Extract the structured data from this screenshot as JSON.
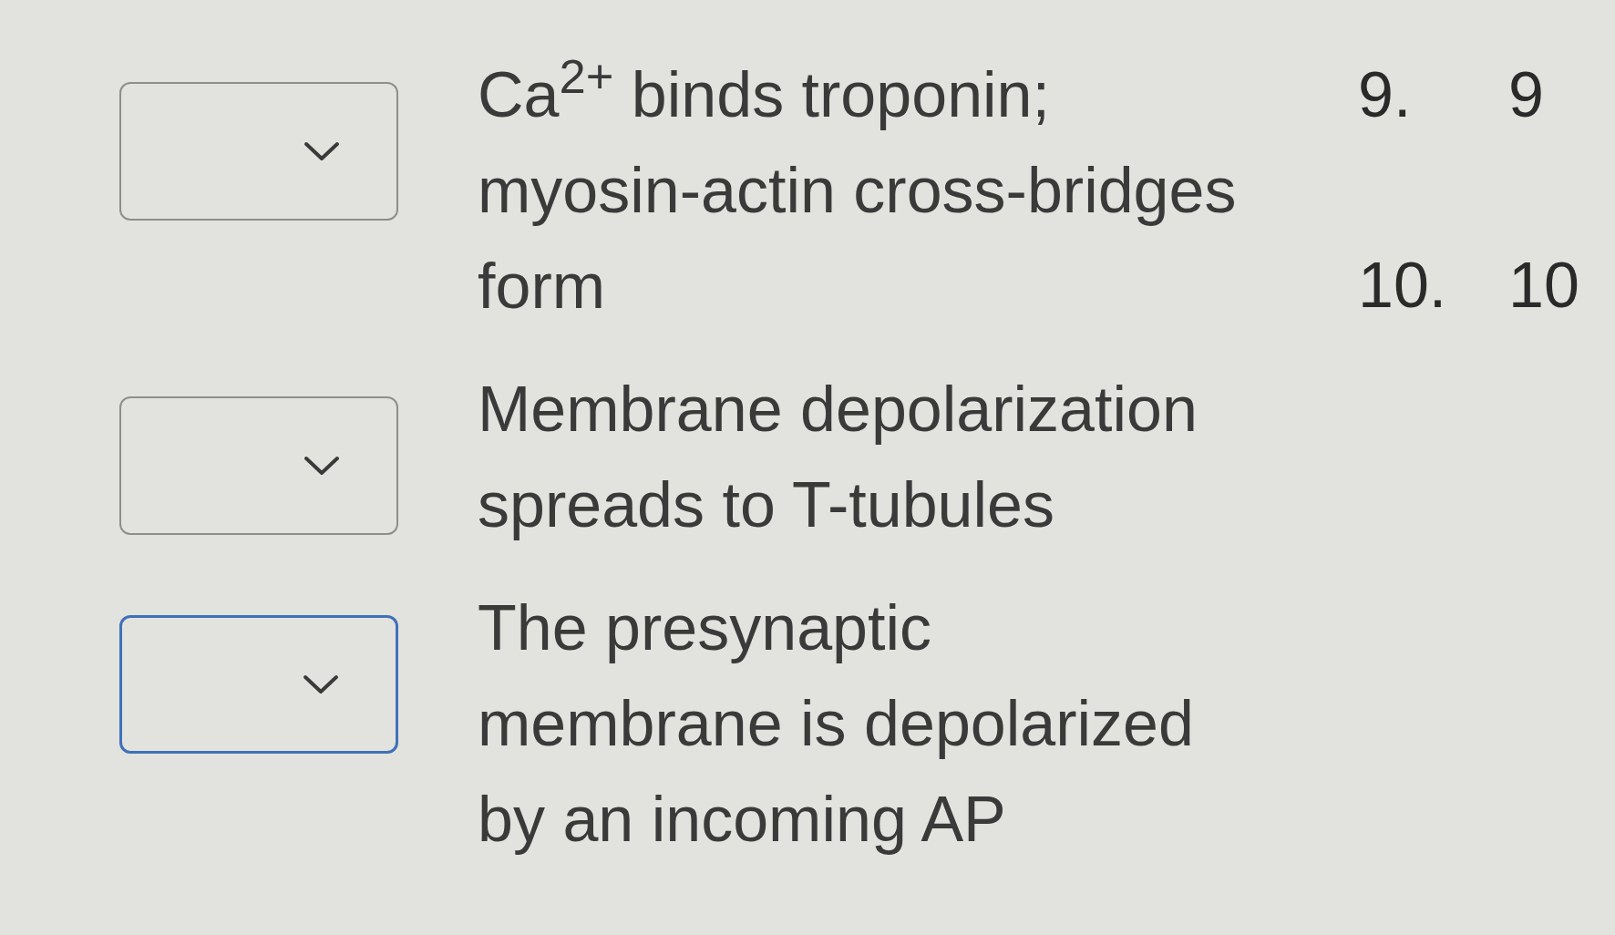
{
  "items": [
    {
      "text": "Ca$^{2+}$ binds troponin; myosin-actin cross-bridges form",
      "dropdown": {
        "focused": false
      }
    },
    {
      "text": "Membrane depolarization spreads to T-tubules",
      "dropdown": {
        "focused": false
      }
    },
    {
      "text": "The presynaptic membrane is depolarized by an incoming AP",
      "dropdown": {
        "focused": true
      }
    }
  ],
  "options": [
    {
      "number": "9.",
      "label": "9"
    },
    {
      "number": "10.",
      "label": "10"
    }
  ]
}
